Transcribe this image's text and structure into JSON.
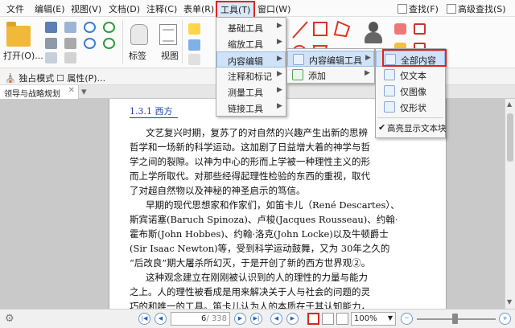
{
  "menubar": {
    "items": [
      "文件",
      "编辑(E)",
      "视图(V)",
      "文档(D)",
      "注释(C)",
      "表单(R)",
      "工具(T)",
      "窗口(W)"
    ],
    "right": [
      "查找(F)",
      "高级查找(S)"
    ]
  },
  "ribbon": {
    "open_label": "打开(O)...",
    "tag_label": "标签",
    "view_label": "视图"
  },
  "toolbar2": {
    "standalone_label": "独占模式",
    "properties_label": "属性(P)..."
  },
  "tab": {
    "title": "领导与战略规划"
  },
  "tools_menu": {
    "items": [
      "基础工具",
      "缩放工具",
      "内容编辑",
      "注释和标记",
      "测量工具",
      "链接工具"
    ]
  },
  "content_edit_menu": {
    "items": [
      "内容编辑工具",
      "添加"
    ]
  },
  "content_edit_tools_menu": {
    "items": [
      "全部内容",
      "仅文本",
      "仅图像",
      "仅形状"
    ],
    "highlight_label": "高亮显示文本块"
  },
  "document": {
    "heading": "1.3.1  西方",
    "lines": [
      "文艺复兴时期，复苏了的对自然的兴趣产生出新的思辨",
      "哲学和一场新的科学运动。这加剧了日益增大着的神学与哲",
      "学之间的裂隙。以神为中心的形而上学被一种理性主义的形",
      "而上学所取代。对那些经得起理性检验的东西的重视，取代",
      "了对超自然物以及神秘的神圣启示的笃信。",
      "早期的现代思想家和作家们，如笛卡儿（René Descartes）、",
      "斯宾诺塞(Baruch Spinoza)、卢梭(Jacques Rousseau)、约翰·",
      "霍布斯(John Hobbes)、约翰·洛克(John Locke)以及牛顿爵士",
      "(Sir Isaac Newton)等，受到科学运动鼓舞，又为 30年之久的",
      "“后改良”期大屠杀所幻灭，于是开创了新的西方世界观②。",
      "这种观念建立在刚刚被认识到的人的理性的力量与能力",
      "之上。人的理性被看成是用来解决关于人与社会的问题的灵",
      "巧的和唯一的工具。笛卡儿认为人的本质在于其认知能力，"
    ]
  },
  "statusbar": {
    "page_value": "6",
    "page_total": "/ 338",
    "zoom": "100%"
  }
}
